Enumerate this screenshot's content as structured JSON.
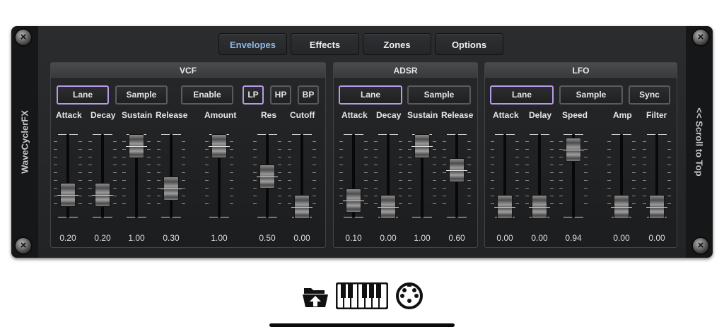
{
  "app": {
    "side_label": "WaveCyclerFX",
    "scroll_label": "<< Scroll to Top"
  },
  "tabs": [
    {
      "label": "Envelopes",
      "active": true
    },
    {
      "label": "Effects"
    },
    {
      "label": "Zones"
    },
    {
      "label": "Options"
    }
  ],
  "accent": "#b99ae8",
  "active_tab_color": "#8fb8e6",
  "vcf": {
    "title": "VCF",
    "buttons": {
      "lane": "Lane",
      "sample": "Sample",
      "enable": "Enable",
      "lp": "LP",
      "hp": "HP",
      "bp": "BP"
    },
    "selected": [
      "Lane",
      "LP"
    ],
    "faders": [
      {
        "label": "Attack",
        "value": "0.20",
        "level": 0.2
      },
      {
        "label": "Decay",
        "value": "0.20",
        "level": 0.2
      },
      {
        "label": "Sustain",
        "value": "1.00",
        "level": 1.0
      },
      {
        "label": "Release",
        "value": "0.30",
        "level": 0.3
      },
      {
        "label": "Amount",
        "value": "1.00",
        "level": 1.0
      },
      {
        "label": "Res",
        "value": "0.50",
        "level": 0.5
      },
      {
        "label": "Cutoff",
        "value": "0.00",
        "level": 0.0
      }
    ]
  },
  "adsr": {
    "title": "ADSR",
    "buttons": {
      "lane": "Lane",
      "sample": "Sample"
    },
    "selected": [
      "Lane"
    ],
    "faders": [
      {
        "label": "Attack",
        "value": "0.10",
        "level": 0.1
      },
      {
        "label": "Decay",
        "value": "0.00",
        "level": 0.0
      },
      {
        "label": "Sustain",
        "value": "1.00",
        "level": 1.0
      },
      {
        "label": "Release",
        "value": "0.60",
        "level": 0.6
      }
    ]
  },
  "lfo": {
    "title": "LFO",
    "buttons": {
      "lane": "Lane",
      "sample": "Sample",
      "sync": "Sync"
    },
    "selected": [
      "Lane"
    ],
    "faders": [
      {
        "label": "Attack",
        "value": "0.00",
        "level": 0.0
      },
      {
        "label": "Delay",
        "value": "0.00",
        "level": 0.0
      },
      {
        "label": "Speed",
        "value": "0.94",
        "level": 0.94
      },
      {
        "label": "Amp",
        "value": "0.00",
        "level": 0.0
      },
      {
        "label": "Filter",
        "value": "0.00",
        "level": 0.0
      }
    ]
  },
  "toolbar_icons": [
    "folder-icon",
    "keyboard-icon",
    "midi-icon"
  ]
}
